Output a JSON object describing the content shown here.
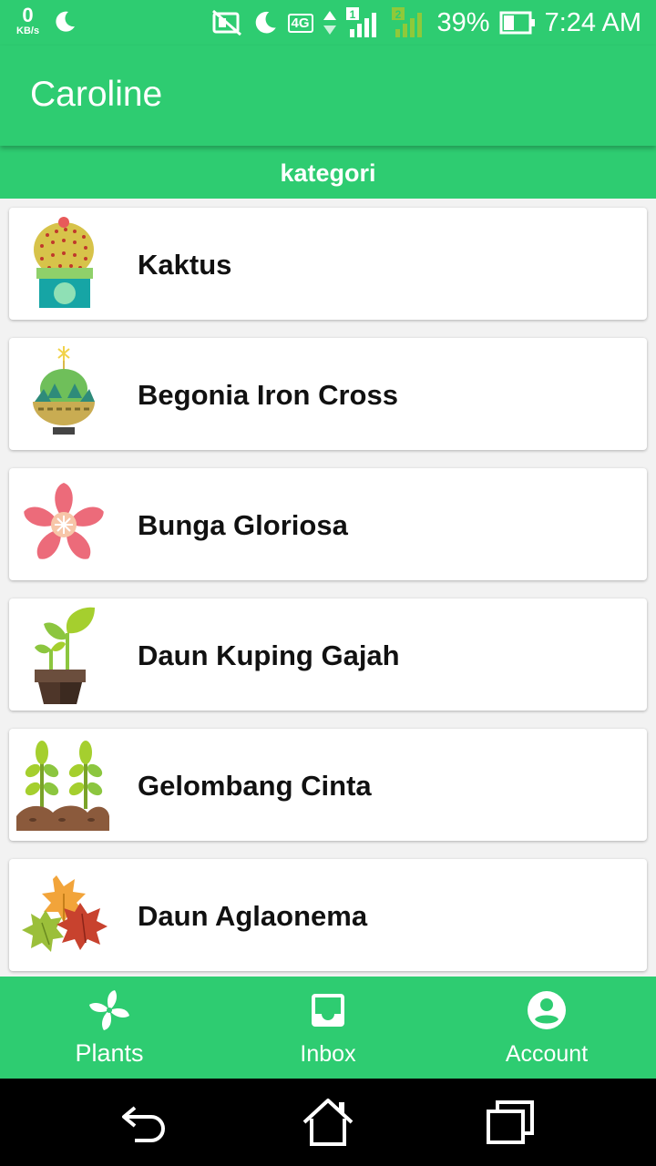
{
  "status_bar": {
    "speed": "0",
    "speed_unit": "KB/s",
    "battery": "39%",
    "time": "7:24 AM",
    "network": "4G",
    "sim_slot": "1",
    "sim2_slot": "2",
    "icons": [
      "moon-icon",
      "no-sim-icon",
      "moon-icon",
      "signal-icon",
      "battery-icon"
    ]
  },
  "app_bar": {
    "title": "Caroline"
  },
  "category_bar": {
    "label": "kategori"
  },
  "plants": [
    {
      "name": "Kaktus",
      "icon": "cactus-icon"
    },
    {
      "name": "Begonia Iron Cross",
      "icon": "potted-succulent-icon"
    },
    {
      "name": "Bunga Gloriosa",
      "icon": "flower-icon"
    },
    {
      "name": "Daun Kuping Gajah",
      "icon": "sprout-pot-icon"
    },
    {
      "name": "Gelombang Cinta",
      "icon": "seedlings-icon"
    },
    {
      "name": "Daun Aglaonema",
      "icon": "autumn-leaves-icon"
    }
  ],
  "bottom_nav": [
    {
      "label": "Plants",
      "icon": "pinwheel-icon",
      "active": true
    },
    {
      "label": "Inbox",
      "icon": "inbox-icon",
      "active": false
    },
    {
      "label": "Account",
      "icon": "account-icon",
      "active": false
    }
  ],
  "colors": {
    "primary": "#2ecc71",
    "text": "#111111",
    "card": "#ffffff"
  }
}
